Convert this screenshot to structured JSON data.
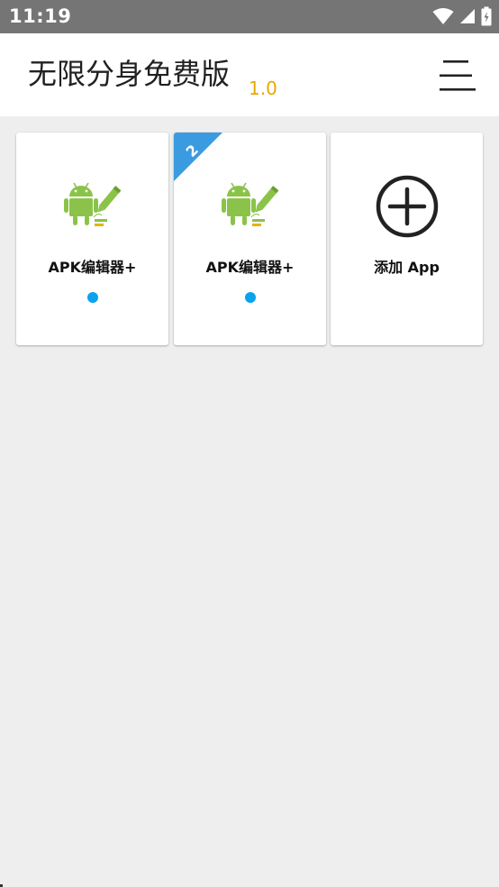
{
  "status_bar": {
    "time": "11:19",
    "icons": [
      "wifi-icon",
      "cell-signal-icon",
      "battery-icon"
    ]
  },
  "app_bar": {
    "title": "无限分身免费版",
    "version": "1.0",
    "menu_icon": "menu-icon"
  },
  "apps": [
    {
      "label": "APK编辑器+",
      "icon": "android-editor-icon",
      "badge": "",
      "running": true
    },
    {
      "label": "APK编辑器+",
      "icon": "android-editor-icon",
      "badge": "2",
      "running": true
    }
  ],
  "add_card": {
    "label": "添加 App",
    "icon": "add-circle-icon"
  },
  "colors": {
    "status_bar": "#757575",
    "background": "#eeeeee",
    "version": "#e8a800",
    "badge": "#3b9be0",
    "running_dot": "#0aa2ec",
    "android_green": "#8bc34a"
  }
}
